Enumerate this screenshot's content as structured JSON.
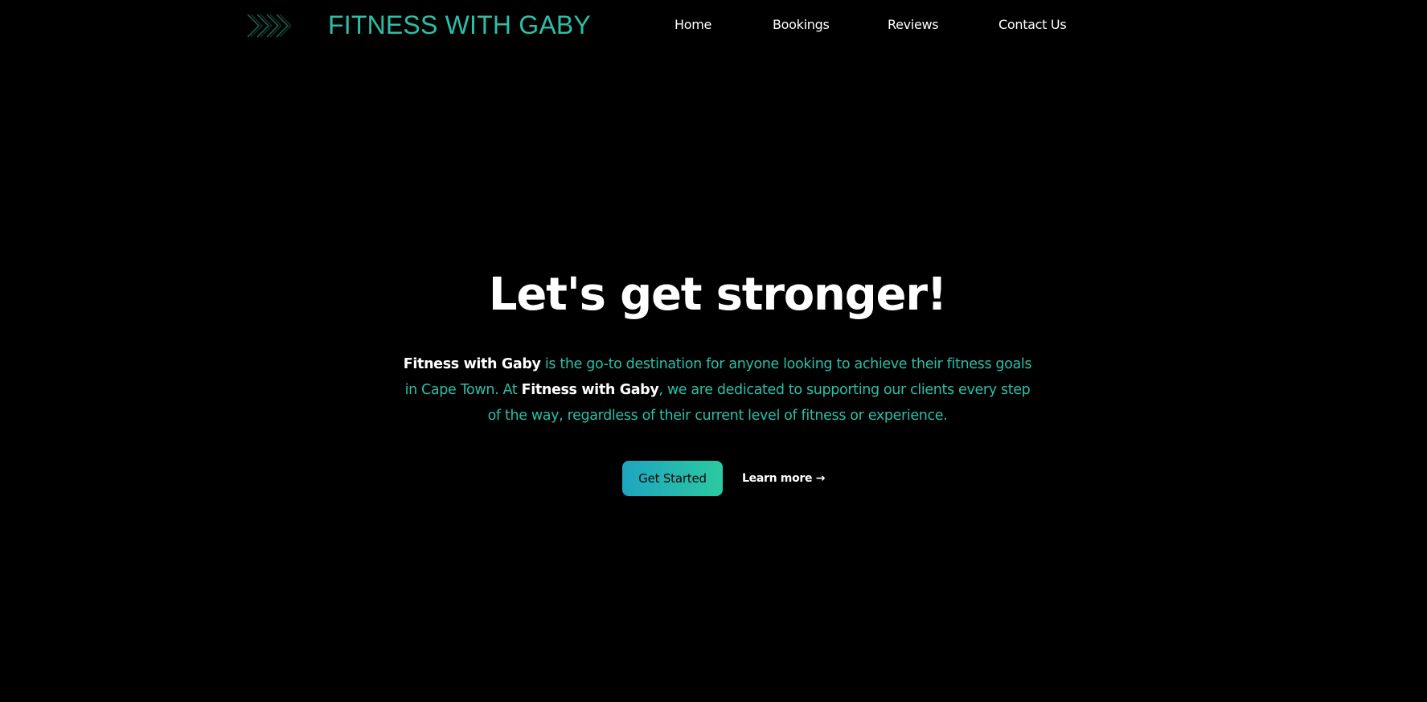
{
  "header": {
    "brand": "FITNESS WITH GABY",
    "logo_icon": "chevrons-right-icon",
    "nav": [
      {
        "label": "Home"
      },
      {
        "label": "Bookings"
      },
      {
        "label": "Reviews"
      },
      {
        "label": "Contact Us"
      }
    ]
  },
  "hero": {
    "title": "Let's get stronger!",
    "description": {
      "brand_1": "Fitness with Gaby",
      "text_1": " is the go-to destination for anyone looking to achieve their fitness goals in Cape Town. At ",
      "brand_2": "Fitness with Gaby",
      "text_2": ", we are dedicated to supporting our clients every step of the way, regardless of their current level of fitness or experience."
    },
    "primary_button": "Get Started",
    "secondary_link": "Learn more →"
  },
  "colors": {
    "background": "#000000",
    "accent": "#2bbfa8",
    "button_gradient_start": "#1ea5c0",
    "button_gradient_end": "#2cc9a0",
    "text": "#ffffff"
  }
}
